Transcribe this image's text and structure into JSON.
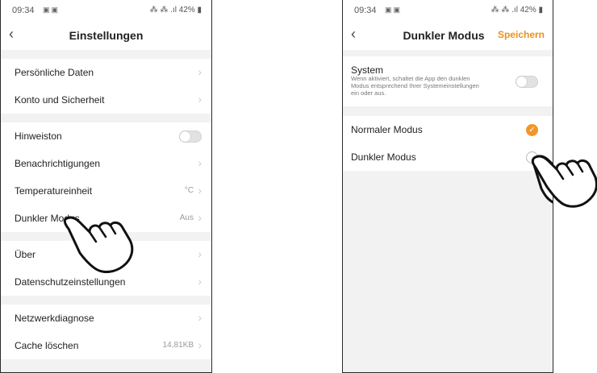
{
  "left_screen": {
    "status": {
      "time": "09:34",
      "right": "42%"
    },
    "header": {
      "title": "Einstellungen"
    },
    "rows": [
      {
        "label": "Persönliche Daten"
      },
      {
        "label": "Konto und Sicherheit"
      },
      {
        "label": "Hinweiston"
      },
      {
        "label": "Benachrichtigungen"
      },
      {
        "label": "Temperatureinheit",
        "value": "°C"
      },
      {
        "label": "Dunkler Modus",
        "value": "Aus"
      },
      {
        "label": "Über"
      },
      {
        "label": "Datenschutzeinstellungen"
      },
      {
        "label": "Netzwerkdiagnose"
      },
      {
        "label": "Cache löschen",
        "value": "14,81KB"
      }
    ]
  },
  "right_screen": {
    "status": {
      "time": "09:34",
      "right": "42%"
    },
    "header": {
      "title": "Dunkler Modus",
      "save": "Speichern"
    },
    "system": {
      "label": "System",
      "description": "Wenn aktiviert, schaltet die App den dunklen Modus entsprechend Ihrer Systemeinstellungen ein oder aus."
    },
    "options": [
      {
        "label": "Normaler Modus",
        "selected": true
      },
      {
        "label": "Dunkler Modus",
        "selected": false
      }
    ]
  },
  "colors": {
    "accent": "#f0962a",
    "background": "#f2f2f2"
  },
  "icons": [
    "back-chevron-icon",
    "chevron-right-icon",
    "toggle-switch",
    "check-icon",
    "pointing-hand-icon"
  ]
}
